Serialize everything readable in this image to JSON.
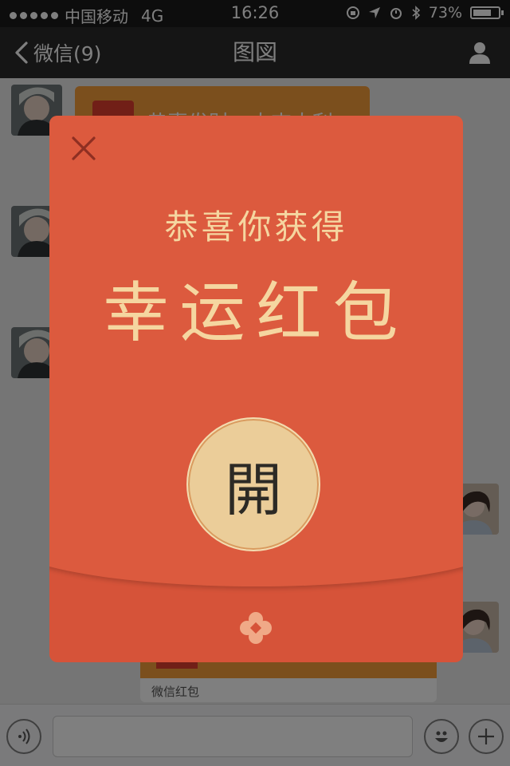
{
  "status_bar": {
    "carrier": "中国移动",
    "network": "4G",
    "time": "16:26",
    "battery": "73%",
    "battery_level": 0.73
  },
  "nav": {
    "back_label": "微信(9)",
    "title": "图図"
  },
  "chat": {
    "bubble_text": "恭喜发财，大吉大利",
    "card_caption": "微信红包"
  },
  "red_packet": {
    "subtitle": "恭喜你获得",
    "headline": "幸运红包",
    "open_label": "開"
  },
  "colors": {
    "packet_red": "#d65339",
    "gold_text": "#f5d6a0",
    "open_button": "#ebcd99",
    "bubble_orange": "#f79e3a"
  }
}
